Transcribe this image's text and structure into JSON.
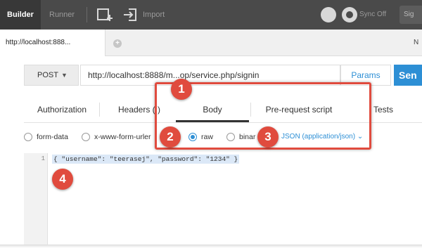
{
  "toolbar": {
    "builder_label": "Builder",
    "runner_label": "Runner",
    "import_label": "Import",
    "sync_label": "Sync Off",
    "sign_label": "Sig",
    "icons": [
      "new-window-icon",
      "import-icon",
      "interceptor-icon",
      "sync-icon"
    ]
  },
  "tabs": {
    "active_tab_label": "http://localhost:888...",
    "right_label": "N"
  },
  "request": {
    "method": "POST",
    "url": "http://localhost:8888/m...op/service.php/signin",
    "params_label": "Params",
    "send_label": "Sen"
  },
  "subtabs": {
    "authorization": "Authorization",
    "headers": "Headers ( )",
    "body": "Body",
    "prerequest": "Pre-request script",
    "tests": "Tests"
  },
  "body_types": {
    "form_data": "form-data",
    "urlencoded": "x-www-form-urler",
    "raw": "raw",
    "binary": "binar",
    "selected": "raw",
    "content_type": "JSON (application/json)"
  },
  "editor": {
    "line_number": "1",
    "code": "{ \"username\": \"teerasej\", \"password\": \"1234\" }"
  },
  "annotations": {
    "step1": "1",
    "step2": "2",
    "step3": "3",
    "step4": "4"
  },
  "colors": {
    "accent": "#2d8fd5",
    "annotation": "#e04b3e",
    "toolbar_bg": "#4a4a4a"
  }
}
